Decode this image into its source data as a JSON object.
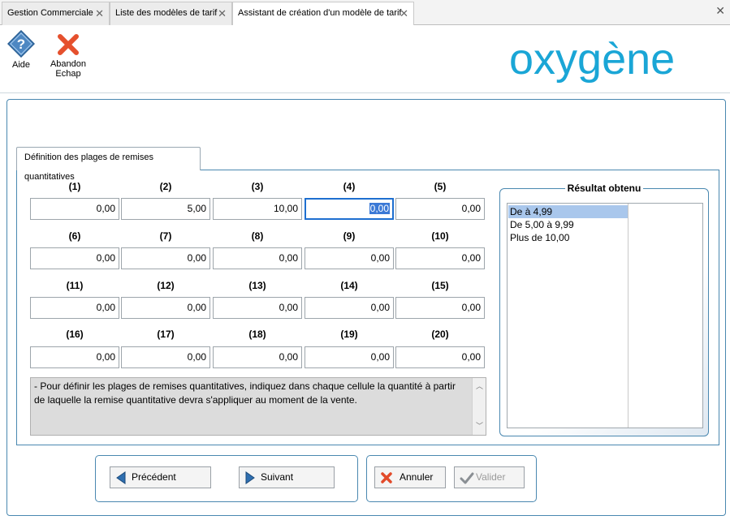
{
  "tabs": [
    {
      "label": "Gestion Commerciale"
    },
    {
      "label": "Liste des modèles de tarif"
    },
    {
      "label": "Assistant de création d'un modèle de tarif"
    }
  ],
  "toolbar": {
    "aide_label": "Aide",
    "abandon_label": "Abandon",
    "abandon_shortcut": "Echap"
  },
  "logo": {
    "text": "oxygène",
    "color": "#1aa6d6"
  },
  "section_tab": {
    "label": "Définition des plages de remises quantitatives"
  },
  "ranges": [
    {
      "num": "(1)",
      "value": "0,00"
    },
    {
      "num": "(2)",
      "value": "5,00"
    },
    {
      "num": "(3)",
      "value": "10,00"
    },
    {
      "num": "(4)",
      "value": "0,00"
    },
    {
      "num": "(5)",
      "value": "0,00"
    },
    {
      "num": "(6)",
      "value": "0,00"
    },
    {
      "num": "(7)",
      "value": "0,00"
    },
    {
      "num": "(8)",
      "value": "0,00"
    },
    {
      "num": "(9)",
      "value": "0,00"
    },
    {
      "num": "(10)",
      "value": "0,00"
    },
    {
      "num": "(11)",
      "value": "0,00"
    },
    {
      "num": "(12)",
      "value": "0,00"
    },
    {
      "num": "(13)",
      "value": "0,00"
    },
    {
      "num": "(14)",
      "value": "0,00"
    },
    {
      "num": "(15)",
      "value": "0,00"
    },
    {
      "num": "(16)",
      "value": "0,00"
    },
    {
      "num": "(17)",
      "value": "0,00"
    },
    {
      "num": "(18)",
      "value": "0,00"
    },
    {
      "num": "(19)",
      "value": "0,00"
    },
    {
      "num": "(20)",
      "value": "0,00"
    }
  ],
  "info_text": "- Pour définir les plages de remises quantitatives, indiquez dans chaque cellule la quantité à partir de laquelle la remise quantitative devra s'appliquer au moment de la vente.",
  "result": {
    "title": "Résultat obtenu",
    "items": [
      "De  à 4,99",
      "De 5,00 à 9,99",
      "Plus de 10,00"
    ]
  },
  "buttons": {
    "previous": "Précédent",
    "next": "Suivant",
    "cancel": "Annuler",
    "validate": "Valider"
  },
  "colors": {
    "accent_border": "#4a88b0",
    "selection": "#a9c7ec",
    "cancel_icon": "#e24a2a",
    "nav_arrow": "#2f6fb0"
  }
}
